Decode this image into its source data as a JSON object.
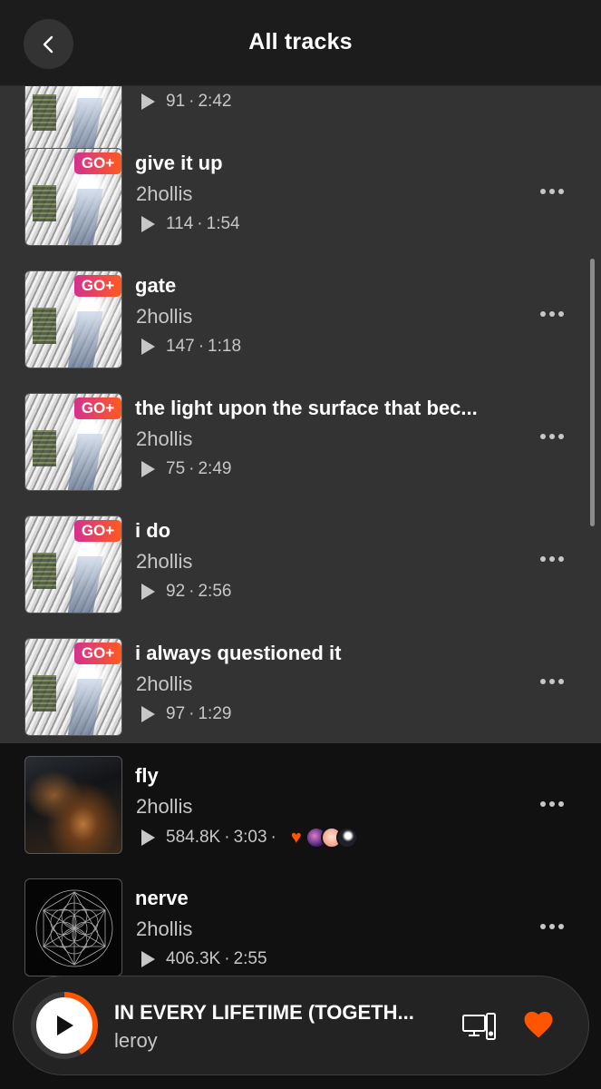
{
  "header": {
    "title": "All tracks",
    "back_icon": "chevron-left-icon"
  },
  "partial_track": {
    "plays": "91",
    "duration": "2:42"
  },
  "tracks": [
    {
      "title": "give it up",
      "artist": "2hollis",
      "plays": "114",
      "duration": "1:54",
      "badge": "GO+"
    },
    {
      "title": "gate",
      "artist": "2hollis",
      "plays": "147",
      "duration": "1:18",
      "badge": "GO+"
    },
    {
      "title": "the light upon the surface that bec...",
      "artist": "2hollis",
      "plays": "75",
      "duration": "2:49",
      "badge": "GO+"
    },
    {
      "title": "i do",
      "artist": "2hollis",
      "plays": "92",
      "duration": "2:56",
      "badge": "GO+"
    },
    {
      "title": "i always questioned it",
      "artist": "2hollis",
      "plays": "97",
      "duration": "1:29",
      "badge": "GO+"
    },
    {
      "title": "fly",
      "artist": "2hollis",
      "plays": "584.8K",
      "duration": "3:03",
      "liked": true
    },
    {
      "title": "nerve",
      "artist": "2hollis",
      "plays": "406.3K",
      "duration": "2:55"
    }
  ],
  "player": {
    "title": "IN EVERY LIFETIME (TOGETH...",
    "artist": "leroy",
    "progress": 0.42,
    "liked": true
  },
  "colors": {
    "accent": "#ff5500",
    "go_gradient_start": "#d4318f",
    "go_gradient_end": "#ff5a1f",
    "go_section_bg": "#333333",
    "page_bg": "#111111"
  }
}
